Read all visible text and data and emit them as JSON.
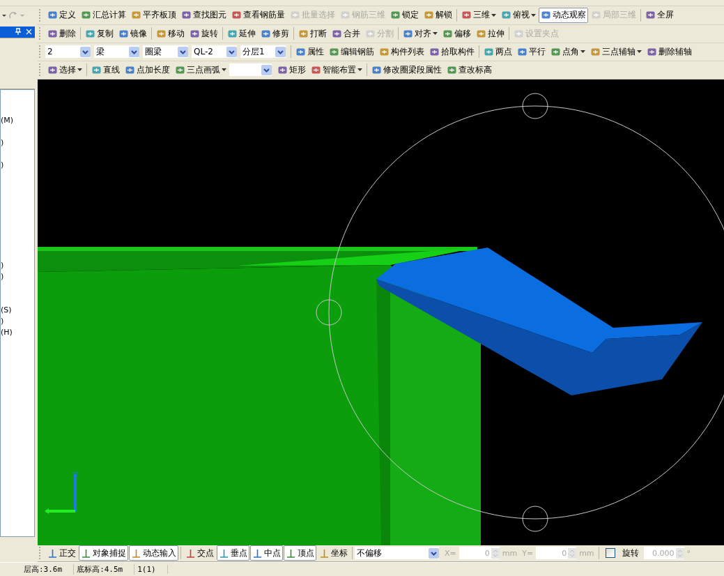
{
  "toolbars": [
    {
      "items": [
        {
          "kind": "button",
          "label": "定义",
          "disabled": false,
          "pressed": false,
          "dropdown": false
        },
        {
          "kind": "button",
          "label": "汇总计算",
          "disabled": false,
          "pressed": false,
          "dropdown": false
        },
        {
          "kind": "button",
          "label": "平齐板顶",
          "disabled": false,
          "pressed": false,
          "dropdown": false
        },
        {
          "kind": "button",
          "label": "查找图元",
          "disabled": false,
          "pressed": false,
          "dropdown": false
        },
        {
          "kind": "button",
          "label": "查看钢筋量",
          "disabled": false,
          "pressed": false,
          "dropdown": false
        },
        {
          "kind": "button",
          "label": "批量选择",
          "disabled": true,
          "pressed": false,
          "dropdown": false
        },
        {
          "kind": "button",
          "label": "钢筋三维",
          "disabled": true,
          "pressed": false,
          "dropdown": false
        },
        {
          "kind": "button",
          "label": "锁定",
          "disabled": false,
          "pressed": false,
          "dropdown": false
        },
        {
          "kind": "button",
          "label": "解锁",
          "disabled": false,
          "pressed": false,
          "dropdown": false
        },
        {
          "kind": "separator"
        },
        {
          "kind": "button",
          "label": "三维",
          "disabled": false,
          "pressed": false,
          "dropdown": true
        },
        {
          "kind": "button",
          "label": "俯视",
          "disabled": false,
          "pressed": false,
          "dropdown": true
        },
        {
          "kind": "button",
          "label": "动态观察",
          "disabled": false,
          "pressed": true,
          "dropdown": false
        },
        {
          "kind": "button",
          "label": "局部三维",
          "disabled": true,
          "pressed": false,
          "dropdown": false
        },
        {
          "kind": "separator"
        },
        {
          "kind": "button",
          "label": "全屏",
          "disabled": false,
          "pressed": false,
          "dropdown": false
        }
      ]
    },
    {
      "items": [
        {
          "kind": "button",
          "label": "删除",
          "disabled": false,
          "pressed": false,
          "dropdown": false
        },
        {
          "kind": "separator"
        },
        {
          "kind": "button",
          "label": "复制",
          "disabled": false,
          "pressed": false,
          "dropdown": false
        },
        {
          "kind": "button",
          "label": "镜像",
          "disabled": false,
          "pressed": false,
          "dropdown": false
        },
        {
          "kind": "separator"
        },
        {
          "kind": "button",
          "label": "移动",
          "disabled": false,
          "pressed": false,
          "dropdown": false
        },
        {
          "kind": "button",
          "label": "旋转",
          "disabled": false,
          "pressed": false,
          "dropdown": false
        },
        {
          "kind": "separator"
        },
        {
          "kind": "button",
          "label": "延伸",
          "disabled": false,
          "pressed": false,
          "dropdown": false
        },
        {
          "kind": "button",
          "label": "修剪",
          "disabled": false,
          "pressed": false,
          "dropdown": false
        },
        {
          "kind": "separator"
        },
        {
          "kind": "button",
          "label": "打断",
          "disabled": false,
          "pressed": false,
          "dropdown": false
        },
        {
          "kind": "button",
          "label": "合并",
          "disabled": false,
          "pressed": false,
          "dropdown": false
        },
        {
          "kind": "button",
          "label": "分割",
          "disabled": true,
          "pressed": false,
          "dropdown": false
        },
        {
          "kind": "separator"
        },
        {
          "kind": "button",
          "label": "对齐",
          "disabled": false,
          "pressed": false,
          "dropdown": true
        },
        {
          "kind": "button",
          "label": "偏移",
          "disabled": false,
          "pressed": false,
          "dropdown": false
        },
        {
          "kind": "button",
          "label": "拉伸",
          "disabled": false,
          "pressed": false,
          "dropdown": false
        },
        {
          "kind": "separator"
        },
        {
          "kind": "button",
          "label": "设置夹点",
          "disabled": true,
          "pressed": false,
          "dropdown": false
        }
      ]
    },
    {
      "items": [
        {
          "kind": "combo",
          "value": "2"
        },
        {
          "kind": "combo",
          "value": "梁"
        },
        {
          "kind": "combo",
          "value": "圈梁"
        },
        {
          "kind": "combo",
          "value": "QL-2"
        },
        {
          "kind": "combo",
          "value": "分层1"
        },
        {
          "kind": "separator"
        },
        {
          "kind": "button",
          "label": "属性",
          "disabled": false,
          "pressed": false,
          "dropdown": false
        },
        {
          "kind": "button",
          "label": "编辑钢筋",
          "disabled": false,
          "pressed": false,
          "dropdown": false
        },
        {
          "kind": "button",
          "label": "构件列表",
          "disabled": false,
          "pressed": false,
          "dropdown": false
        },
        {
          "kind": "button",
          "label": "拾取构件",
          "disabled": false,
          "pressed": false,
          "dropdown": false
        },
        {
          "kind": "separator"
        },
        {
          "kind": "button",
          "label": "两点",
          "disabled": false,
          "pressed": false,
          "dropdown": false
        },
        {
          "kind": "button",
          "label": "平行",
          "disabled": false,
          "pressed": false,
          "dropdown": false
        },
        {
          "kind": "button",
          "label": "点角",
          "disabled": false,
          "pressed": false,
          "dropdown": true
        },
        {
          "kind": "button",
          "label": "三点辅轴",
          "disabled": false,
          "pressed": false,
          "dropdown": true
        },
        {
          "kind": "button",
          "label": "删除辅轴",
          "disabled": false,
          "pressed": false,
          "dropdown": false
        }
      ]
    },
    {
      "items": [
        {
          "kind": "button",
          "label": "选择",
          "disabled": false,
          "pressed": false,
          "dropdown": true
        },
        {
          "kind": "separator"
        },
        {
          "kind": "button",
          "label": "直线",
          "disabled": false,
          "pressed": false,
          "dropdown": false
        },
        {
          "kind": "button",
          "label": "点加长度",
          "disabled": false,
          "pressed": false,
          "dropdown": false
        },
        {
          "kind": "button",
          "label": "三点画弧",
          "disabled": false,
          "pressed": false,
          "dropdown": true
        },
        {
          "kind": "combo"
        },
        {
          "kind": "button",
          "label": "矩形",
          "disabled": false,
          "pressed": false,
          "dropdown": false
        },
        {
          "kind": "button",
          "label": "智能布置",
          "disabled": false,
          "pressed": false,
          "dropdown": true
        },
        {
          "kind": "separator"
        },
        {
          "kind": "button",
          "label": "修改圈梁段属性",
          "disabled": false,
          "pressed": false,
          "dropdown": false
        },
        {
          "kind": "button",
          "label": "查改标高",
          "disabled": false,
          "pressed": false,
          "dropdown": false
        }
      ]
    }
  ],
  "tree_rows": [
    {},
    {},
    {
      "text": "(M)"
    },
    {},
    {
      "text": ")"
    },
    {},
    {
      "text": ")"
    },
    {},
    {},
    {},
    {},
    {},
    {},
    {},
    {},
    {
      "text": ")"
    },
    {
      "text": ")"
    },
    {},
    {},
    {
      "text": "(S)"
    },
    {
      "text": ")"
    },
    {
      "text": "(H)"
    }
  ],
  "snap_toolbar": {
    "items": [
      {
        "kind": "button",
        "label": "正交",
        "disabled": false,
        "pressed": false
      },
      {
        "kind": "button",
        "label": "对象捕捉",
        "disabled": false,
        "pressed": true
      },
      {
        "kind": "button",
        "label": "动态输入",
        "disabled": false,
        "pressed": true
      },
      {
        "kind": "separator"
      },
      {
        "kind": "button",
        "label": "交点",
        "disabled": false,
        "pressed": false
      },
      {
        "kind": "button",
        "label": "垂点",
        "disabled": false,
        "pressed": true
      },
      {
        "kind": "button",
        "label": "中点",
        "disabled": false,
        "pressed": true
      },
      {
        "kind": "button",
        "label": "顶点",
        "disabled": false,
        "pressed": true
      },
      {
        "kind": "button",
        "label": "坐标",
        "disabled": false,
        "pressed": false
      },
      {
        "kind": "separator"
      },
      {
        "kind": "combo",
        "value": "不偏移"
      },
      {
        "kind": "label",
        "text": "X=",
        "disabled": true
      },
      {
        "kind": "spin",
        "value": "0",
        "disabled": true
      },
      {
        "kind": "label",
        "text": "mm",
        "disabled": true
      },
      {
        "kind": "label",
        "text": "Y=",
        "disabled": true
      },
      {
        "kind": "spin",
        "value": "0",
        "disabled": true
      },
      {
        "kind": "label",
        "text": "mm",
        "disabled": true
      },
      {
        "kind": "separator"
      },
      {
        "kind": "checkbox",
        "label": "旋转",
        "checked": false
      },
      {
        "kind": "spin",
        "value": "0.000",
        "disabled": true
      },
      {
        "kind": "label",
        "text": "°",
        "disabled": true
      }
    ]
  },
  "status_bar": [
    "层高:3.6m",
    "底标高:4.5m",
    "1(1)"
  ]
}
